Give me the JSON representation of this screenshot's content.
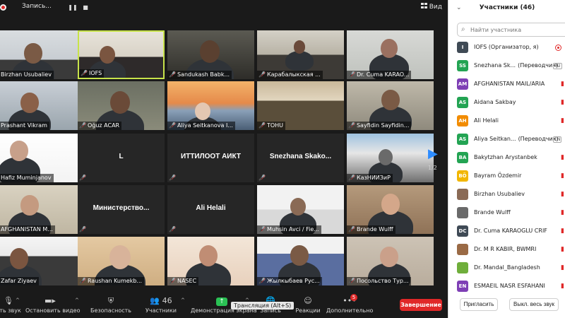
{
  "recording": {
    "label": "Запись..."
  },
  "view_button": {
    "label": "Вид"
  },
  "pager": {
    "page": "1/2"
  },
  "tiles": [
    {
      "name": "Birzhan Usubaliev"
    },
    {
      "name": "IOFS"
    },
    {
      "name": "Sandukash Babk..."
    },
    {
      "name": "Карабалыкская ..."
    },
    {
      "name": "Dr. Cuma KARAO..."
    },
    {
      "name": "Prashant Vikram"
    },
    {
      "name": "Oğuz ACAR"
    },
    {
      "name": "Aliya Seitkanova I..."
    },
    {
      "name": "TOHU"
    },
    {
      "name": "Sayfidin Sayfidin..."
    },
    {
      "name": "Hafiz Muminjanov"
    },
    {
      "center": "L"
    },
    {
      "center": "ИТТИЛООТ АИКТ"
    },
    {
      "center": "Snezhana  Skako..."
    },
    {
      "name": "КазНИИЗиР"
    },
    {
      "name": "AFGHANISTAN M..."
    },
    {
      "center": "Министерство..."
    },
    {
      "center": "Ali Helali"
    },
    {
      "name": "Muhsin Avci / Fie..."
    },
    {
      "name": "Brande Wulff"
    },
    {
      "name": "Zafar Ziyaev"
    },
    {
      "name": "Raushan Kumekb..."
    },
    {
      "name": "NASEC"
    },
    {
      "name": "Жылкыбаев Рус..."
    },
    {
      "name": "Посольство Тур..."
    }
  ],
  "toolbar": {
    "audio": "ить звук",
    "video": "Остановить видео",
    "security": "Безопасность",
    "participants": "Участники",
    "participants_count": "46",
    "share": "Демонстрация экрана",
    "record": "Запись",
    "reactions": "Реакции",
    "more": "Дополнительно",
    "more_badge": "5",
    "tooltip": "Трансляция (Alt+S)",
    "end": "Завершение"
  },
  "panel": {
    "title": "Участники (46)",
    "search_placeholder": "Найти участника",
    "participants": [
      {
        "initials": "I",
        "color": "#3f4a55",
        "name": "IOFS (Организатор, я)"
      },
      {
        "initials": "SS",
        "color": "#23a453",
        "name": "Snezhana Sk...",
        "role": "(Переводчик)",
        "tag": "RU"
      },
      {
        "initials": "AM",
        "color": "#7e3fb5",
        "name": "AFGHANISTAN MAIL/ARIA"
      },
      {
        "initials": "AS",
        "color": "#23a453",
        "name": "Aidana Sakbay"
      },
      {
        "initials": "AH",
        "color": "#f28c00",
        "name": "Ali Helali"
      },
      {
        "initials": "AS",
        "color": "#23a453",
        "name": "Aliya Seitkan...",
        "role": "(Переводчик)",
        "tag": "EN"
      },
      {
        "initials": "BA",
        "color": "#23a453",
        "name": "Bakytzhan Arystanbek"
      },
      {
        "initials": "BÖ",
        "color": "#f2b600",
        "name": "Bayram Özdemir"
      },
      {
        "initials": "",
        "color": "#8a6a55",
        "name": "Birzhan Usubaliev"
      },
      {
        "initials": "",
        "color": "#6a6a6a",
        "name": "Brande Wulff"
      },
      {
        "initials": "DC",
        "color": "#3f4a55",
        "name": "Dr. Cuma KARAOGLU CRIF"
      },
      {
        "initials": "",
        "color": "#9a6a45",
        "name": "Dr. M R KABIR, BWMRI"
      },
      {
        "initials": "",
        "color": "#6fae3b",
        "name": "Dr. Mandal_Bangladesh"
      },
      {
        "initials": "EN",
        "color": "#7e3fb5",
        "name": "ESMAEIL NASR ESFAHANI"
      }
    ],
    "invite": "Пригласить",
    "mute_all": "Выкл. весь звук"
  }
}
